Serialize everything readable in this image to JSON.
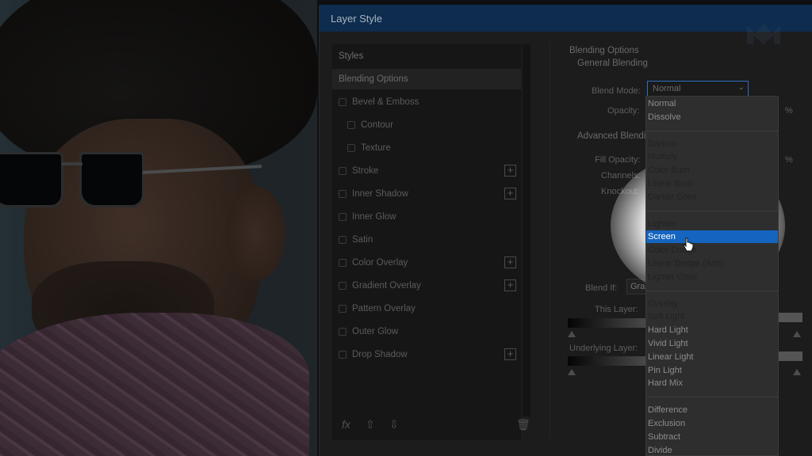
{
  "dialog": {
    "title": "Layer Style"
  },
  "styles_list": {
    "header": "Styles",
    "active": "Blending Options",
    "items": [
      {
        "label": "Bevel & Emboss",
        "has_plus": false,
        "indent": 0
      },
      {
        "label": "Contour",
        "has_plus": false,
        "indent": 1
      },
      {
        "label": "Texture",
        "has_plus": false,
        "indent": 1
      },
      {
        "label": "Stroke",
        "has_plus": true,
        "indent": 0
      },
      {
        "label": "Inner Shadow",
        "has_plus": true,
        "indent": 0
      },
      {
        "label": "Inner Glow",
        "has_plus": false,
        "indent": 0
      },
      {
        "label": "Satin",
        "has_plus": false,
        "indent": 0
      },
      {
        "label": "Color Overlay",
        "has_plus": true,
        "indent": 0
      },
      {
        "label": "Gradient Overlay",
        "has_plus": true,
        "indent": 0
      },
      {
        "label": "Pattern Overlay",
        "has_plus": false,
        "indent": 0
      },
      {
        "label": "Outer Glow",
        "has_plus": false,
        "indent": 0
      },
      {
        "label": "Drop Shadow",
        "has_plus": true,
        "indent": 0
      }
    ],
    "bottom_tools": {
      "fx": "fx",
      "up": "⇧",
      "down": "⇩",
      "trash": "🗑"
    }
  },
  "options": {
    "section_title": "Blending Options",
    "general": "General Blending",
    "blend_mode_label": "Blend Mode:",
    "blend_mode_value": "Normal",
    "opacity_label": "Opacity:",
    "percent": "%",
    "advanced": "Advanced Blendi",
    "fill_opacity_label": "Fill Opacity:",
    "channels_label": "Channels:",
    "knockout_label": "Knockout:",
    "blend_if_label": "Blend If:",
    "blend_if_value": "Gra",
    "this_layer_label": "This Layer:",
    "underlying_label": "Underlying Layer:"
  },
  "dropdown": {
    "selected": "Screen",
    "groups": [
      [
        "Normal",
        "Dissolve"
      ],
      [
        "Darken",
        "Multiply",
        "Color Burn",
        "Linear Burn",
        "Darker Color"
      ],
      [
        "Lighten",
        "Screen",
        "Color Dodge",
        "Linear Dodge (Add)",
        "Lighter Color"
      ],
      [
        "Overlay",
        "Soft Light",
        "Hard Light",
        "Vivid Light",
        "Linear Light",
        "Pin Light",
        "Hard Mix"
      ],
      [
        "Difference",
        "Exclusion",
        "Subtract",
        "Divide"
      ]
    ]
  },
  "colors": {
    "title_bar": "#0d2c4e",
    "selection": "#1565c0",
    "dialog_bg": "#1c1c1c"
  }
}
